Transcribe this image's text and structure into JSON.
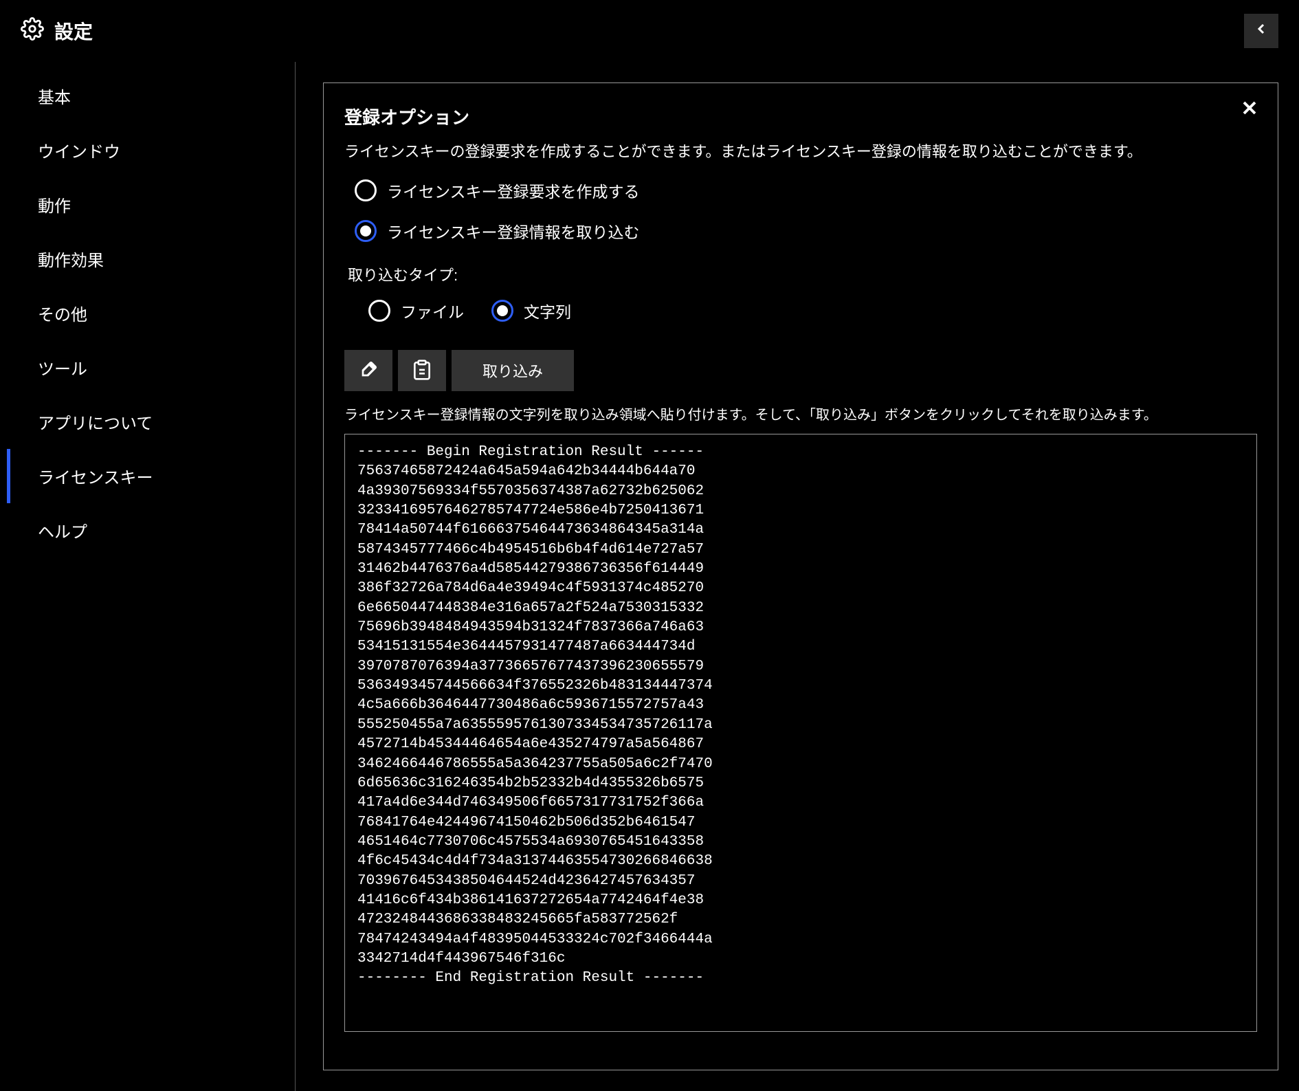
{
  "header": {
    "title": "設定"
  },
  "sidebar": {
    "items": [
      {
        "label": "基本"
      },
      {
        "label": "ウインドウ"
      },
      {
        "label": "動作"
      },
      {
        "label": "動作効果"
      },
      {
        "label": "その他"
      },
      {
        "label": "ツール"
      },
      {
        "label": "アプリについて"
      },
      {
        "label": "ライセンスキー"
      },
      {
        "label": "ヘルプ"
      }
    ],
    "activeIndex": 7
  },
  "panel": {
    "title": "登録オプション",
    "description": "ライセンスキーの登録要求を作成することができます。またはライセンスキー登録の情報を取り込むことができます。",
    "option1": "ライセンスキー登録要求を作成する",
    "option2": "ライセンスキー登録情報を取り込む",
    "importTypeLabel": "取り込むタイプ:",
    "importTypeFile": "ファイル",
    "importTypeString": "文字列",
    "importButton": "取り込み",
    "hint": "ライセンスキー登録情報の文字列を取り込み領域へ貼り付けます。そして、「取り込み」ボタンをクリックしてそれを取り込みます。",
    "registrationText": "------- Begin Registration Result ------\n75637465872424a645a594a642b34444b644a70\n4a39307569334f5570356374387a62732b625062\n32334169576462785747724e586e4b7250413671\n78414a50744f61666375464473634864345a314a\n5874345777466c4b4954516b6b4f4d614e727a57\n31462b4476376a4d58544279386736356f614449\n386f32726a784d6a4e39494c4f5931374c485270\n6e6650447448384e316a657a2f524a7530315332\n75696b3948484943594b31324f7837366a746a63\n53415131554e3644457931477487a663444734d\n3970787076394a37736657677437396230655579\n536349345744566634f376552326b483134447374\n4c5a666b3646447730486a6c5936715572757a43\n555250455a7a6355595761307334534735726117a\n4572714b45344464654a6e435274797a5a564867\n3462466446786555a5a364237755a505a6c2f7470\n6d65636c316246354b2b52332b4d4355326b6575\n417a4d6e344d746349506f6657317731752f366a\n76841764e42449674150462b506d352b6461547\n4651464c7730706c4575534a6930765451643358\n4f6c45434c4d4f734a31374463554730266846638\n7039676453438504644524d4236427457634357\n41416c6f434b386141637272654a7742464f4e38\n4723248443686338483245665fa583772562f\n78474243494a4f48395044533324c702f3466444a\n3342714d4f443967546f316c\n-------- End Registration Result -------"
  }
}
